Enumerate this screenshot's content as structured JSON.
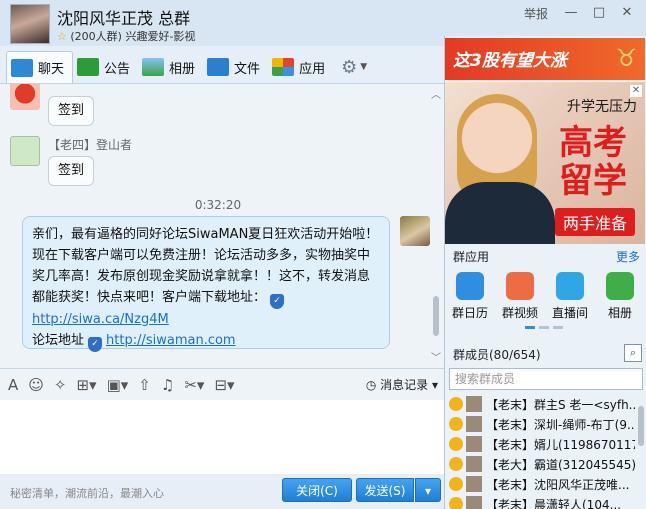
{
  "header": {
    "group_name": "沈阳风华正茂 总群",
    "meta": "(200人群) 兴趣爱好-影视",
    "report_label": "举报"
  },
  "tabs": [
    {
      "label": "聊天",
      "icon": "chat-bubble-icon"
    },
    {
      "label": "公告",
      "icon": "megaphone-icon"
    },
    {
      "label": "相册",
      "icon": "photo-icon"
    },
    {
      "label": "文件",
      "icon": "folder-icon"
    },
    {
      "label": "应用",
      "icon": "apps-grid-icon"
    }
  ],
  "chat": {
    "msg1": {
      "bubble": "签到"
    },
    "msg2": {
      "sender": "【老四】登山者",
      "bubble": "签到"
    },
    "timestamp": "0:32:20",
    "msg3": {
      "text": "亲们，最有逼格的同好论坛SiwaMAN夏日狂欢活动开始啦！现在下载客户端可以免费注册！论坛活动多多，实物抽奖中奖几率高！发布原创现金奖励说拿就拿！！这不，转发消息都能获奖！快点来吧！客户端下载地址：",
      "link1": "http://siwa.ca/Nzg4M",
      "text2": "论坛地址",
      "link2": "http://siwaman.com"
    }
  },
  "input_tools": {
    "history_label": "消息记录"
  },
  "bottom": {
    "slogan": "秘密清单，潮流前沿，最潮入心",
    "close_label": "关闭(C)",
    "send_label": "发送(S)"
  },
  "right": {
    "ad1_text": "这3股有望大涨",
    "ad2_line1": "升学无压力",
    "ad2_big": "高考留学",
    "ad2_pill": "两手准备",
    "apps_title": "群应用",
    "apps_more": "更多",
    "apps": [
      {
        "label": "群日历",
        "icon": "calendar-icon"
      },
      {
        "label": "群视频",
        "icon": "video-icon"
      },
      {
        "label": "直播间",
        "icon": "tv-icon"
      },
      {
        "label": "相册",
        "icon": "photo-icon"
      }
    ],
    "members_title": "群成员(80/654)",
    "search_placeholder": "搜索群成员",
    "members": [
      "【老末】群主S 老一<syfh...",
      "【老末】深圳-绳师-布丁(9...",
      "【老末】婿儿(1198670117)",
      "【老大】霸道(312045545)",
      "【老末】沈阳风华正茂唯...",
      "【老末】晨潇轻人(104..."
    ]
  }
}
